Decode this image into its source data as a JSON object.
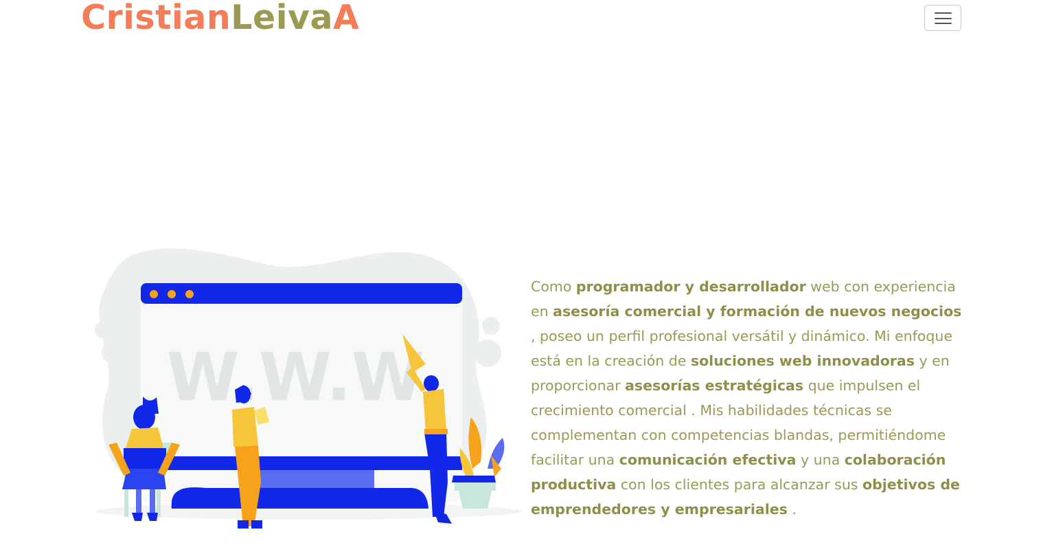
{
  "navbar": {
    "brand_part1": "Cristian",
    "brand_part2": "Leiva",
    "brand_part3": "A",
    "menu_toggle_icon": "hamburger-icon"
  },
  "hero": {
    "illustration": {
      "icon": "website-team-illustration",
      "screen_text": "W.W.W"
    },
    "about": {
      "t1": "Como ",
      "b1": "programador y desarrollador",
      "t2": " web con experiencia en ",
      "b2": "asesoría comercial y formación de nuevos negocios",
      "t3": " , poseo un perfil profesional versátil y dinámico. Mi enfoque está en la creación de ",
      "b3": "soluciones web innovadoras",
      "t4": " y en proporcionar ",
      "b4": "asesorías estratégicas",
      "t5": " que impulsen el crecimiento comercial . Mis habilidades técnicas se complementan con competencias blandas, permitiéndome facilitar una ",
      "b5": "comunicación efectiva",
      "t6": " y una ",
      "b6": "colaboración productiva",
      "t7": " con los clientes para alcanzar sus ",
      "b7": "objetivos de emprendedores y empresariales",
      "t8": " ."
    }
  },
  "colors": {
    "brand_orange": "#f47c56",
    "brand_olive": "#9a9a52",
    "text_olive": "#9a9a52",
    "illustration_blue": "#1128e8",
    "illustration_yellow": "#f6c53a",
    "illustration_orange": "#f7a21b",
    "background": "#ffffff"
  }
}
